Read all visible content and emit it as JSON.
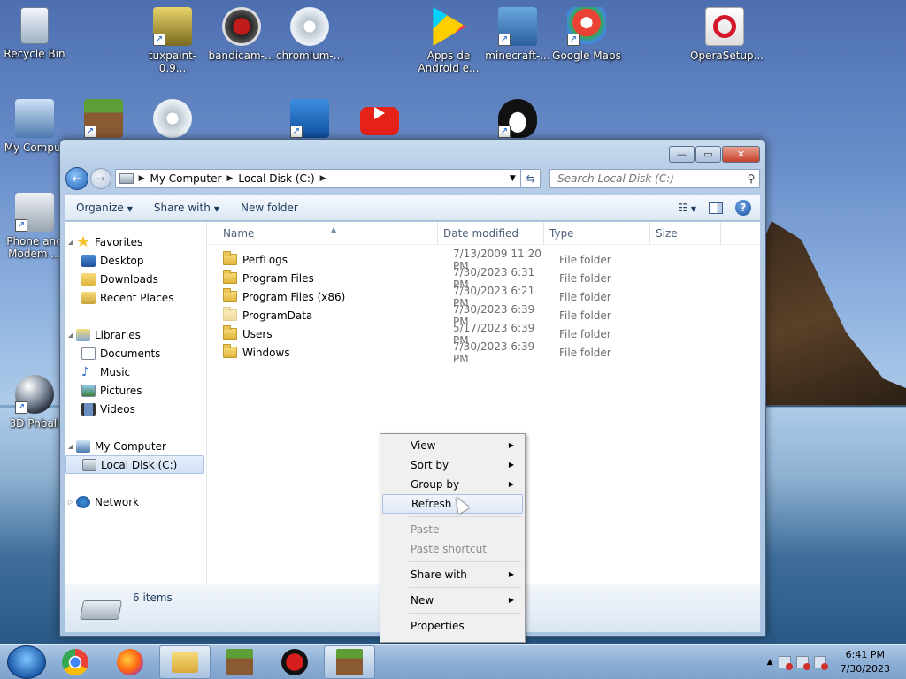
{
  "desktop": {
    "icons": [
      {
        "label": "Recycle Bin"
      },
      {
        "label": "tuxpaint-0.9..."
      },
      {
        "label": "bandicam-..."
      },
      {
        "label": "chromium-..."
      },
      {
        "label": "Apps de Android e..."
      },
      {
        "label": "minecraft-..."
      },
      {
        "label": "Google Maps"
      },
      {
        "label": "OperaSetup..."
      },
      {
        "label": "My Comput"
      },
      {
        "label": "Phone and Modem ..."
      },
      {
        "label": "3D Pnball"
      }
    ]
  },
  "window": {
    "address": {
      "crumbs": [
        "My Computer",
        "Local Disk (C:)"
      ]
    },
    "search": {
      "placeholder": "Search Local Disk (C:)"
    },
    "toolbar": {
      "organize": "Organize",
      "share_with": "Share with",
      "new_folder": "New folder"
    },
    "nav": {
      "favorites": "Favorites",
      "desktop": "Desktop",
      "downloads": "Downloads",
      "recent_places": "Recent Places",
      "libraries": "Libraries",
      "documents": "Documents",
      "music": "Music",
      "pictures": "Pictures",
      "videos": "Videos",
      "my_computer": "My Computer",
      "local_disk": "Local Disk (C:)",
      "network": "Network"
    },
    "columns": {
      "name": "Name",
      "date": "Date modified",
      "type": "Type",
      "size": "Size"
    },
    "files": [
      {
        "name": "PerfLogs",
        "date": "7/13/2009 11:20 PM",
        "type": "File folder"
      },
      {
        "name": "Program Files",
        "date": "7/30/2023 6:31 PM",
        "type": "File folder"
      },
      {
        "name": "Program Files (x86)",
        "date": "7/30/2023 6:21 PM",
        "type": "File folder"
      },
      {
        "name": "ProgramData",
        "date": "7/30/2023 6:39 PM",
        "type": "File folder"
      },
      {
        "name": "Users",
        "date": "5/17/2023 6:39 PM",
        "type": "File folder"
      },
      {
        "name": "Windows",
        "date": "7/30/2023 6:39 PM",
        "type": "File folder"
      }
    ],
    "status": "6 items"
  },
  "context_menu": {
    "view": "View",
    "sort_by": "Sort by",
    "group_by": "Group by",
    "refresh": "Refresh",
    "paste": "Paste",
    "paste_shortcut": "Paste shortcut",
    "share_with": "Share with",
    "new": "New",
    "properties": "Properties"
  },
  "taskbar": {
    "time": "6:41 PM",
    "date": "7/30/2023"
  },
  "colors": {
    "accent": "#1c5fb8",
    "taskbar": "#8eb0d6"
  }
}
